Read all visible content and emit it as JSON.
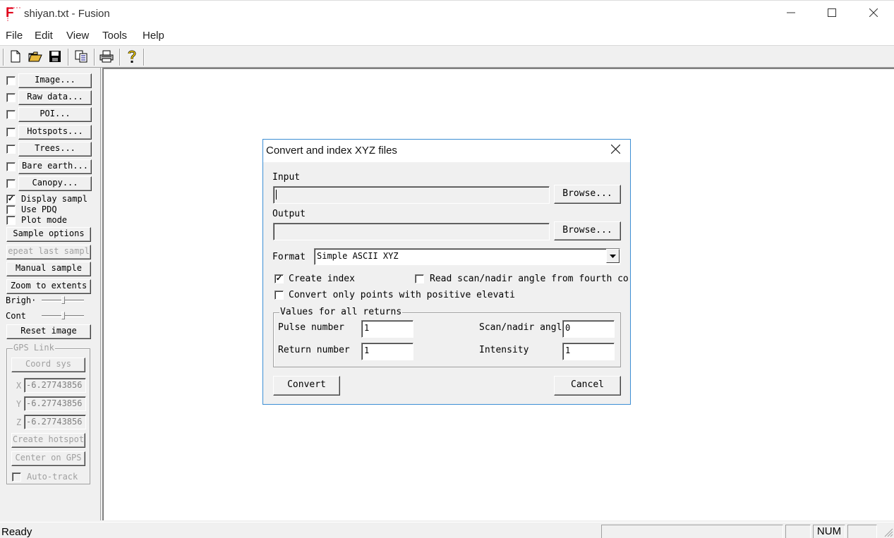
{
  "window": {
    "icon_letter": "F",
    "title": "shiyan.txt - Fusion",
    "minimize_glyph": "—",
    "maximize_glyph": "☐",
    "close_glyph": "✕"
  },
  "menu": [
    "File",
    "Edit",
    "View",
    "Tools",
    "Help"
  ],
  "toolbar": {
    "icons": [
      "new-file-icon",
      "open-folder-icon",
      "save-icon",
      "copy-icon",
      "print-icon",
      "help-icon"
    ]
  },
  "left_panel": {
    "layers": [
      {
        "label": "Image...",
        "checked": false
      },
      {
        "label": "Raw data...",
        "checked": false
      },
      {
        "label": "POI...",
        "checked": false
      },
      {
        "label": "Hotspots...",
        "checked": false
      },
      {
        "label": "Trees...",
        "checked": false
      },
      {
        "label": "Bare earth...",
        "checked": false
      },
      {
        "label": "Canopy...",
        "checked": false
      }
    ],
    "options": [
      {
        "label": "Display sampl",
        "checked": true
      },
      {
        "label": "Use PDQ",
        "checked": false
      },
      {
        "label": "Plot mode",
        "checked": false
      }
    ],
    "sample_options": "Sample options",
    "repeat_last_sample": "epeat last sampl",
    "manual_sample": "Manual sample",
    "zoom_to_extents": "Zoom to extents",
    "brightness_label": "Brigh·",
    "contrast_label": "Cont",
    "reset_image": "Reset image",
    "gps": {
      "title": "GPS Link",
      "coord_sys": "Coord sys",
      "x_label": "X",
      "y_label": "Y",
      "z_label": "Z",
      "x_value": "-6.27743856",
      "y_value": "-6.27743856",
      "z_value": "-6.27743856",
      "create_hotspot": "Create hotspot",
      "center_on_gps": "Center on GPS",
      "auto_track": "Auto-track"
    }
  },
  "dialog": {
    "title": "Convert and index XYZ files",
    "close_glyph": "✕",
    "input_label": "Input",
    "input_value": "",
    "output_label": "Output",
    "output_value": "",
    "browse_label": "Browse...",
    "format_label": "Format",
    "format_value": "Simple ASCII XYZ",
    "create_index_label": "Create index",
    "create_index_checked": true,
    "read_scan_label": "Read scan/nadir angle from fourth co",
    "read_scan_checked": false,
    "convert_positive_label": "Convert only points with positive elevati",
    "convert_positive_checked": false,
    "values_group_title": "Values for all returns",
    "pulse_number_label": "Pulse number",
    "pulse_number_value": "1",
    "return_number_label": "Return number",
    "return_number_value": "1",
    "scan_nadir_label": "Scan/nadir angl",
    "scan_nadir_value": "0",
    "intensity_label": "Intensity",
    "intensity_value": "1",
    "convert_button": "Convert",
    "cancel_button": "Cancel"
  },
  "status": {
    "text": "Ready",
    "num": "NUM"
  }
}
